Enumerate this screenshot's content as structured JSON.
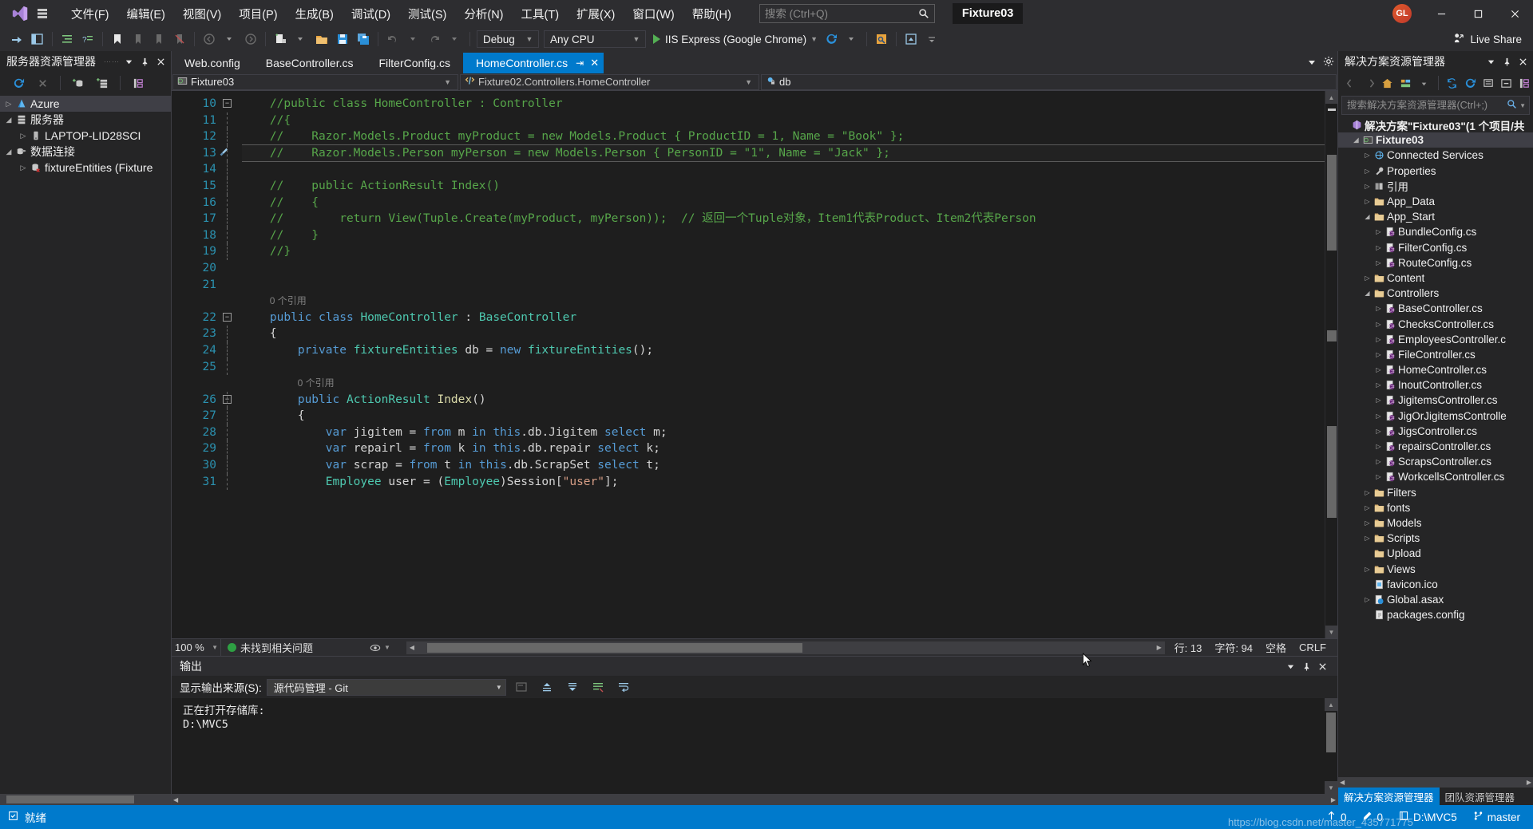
{
  "titlebar": {
    "menus": [
      "文件(F)",
      "编辑(E)",
      "视图(V)",
      "项目(P)",
      "生成(B)",
      "调试(D)",
      "测试(S)",
      "分析(N)",
      "工具(T)",
      "扩展(X)",
      "窗口(W)",
      "帮助(H)"
    ],
    "search_placeholder": "搜索 (Ctrl+Q)",
    "solution_chip": "Fixture03",
    "avatar_initials": "GL",
    "minimize": "—",
    "maximize": "▢",
    "close": "✕"
  },
  "toolbar": {
    "config": "Debug",
    "platform": "Any CPU",
    "run_target": "IIS Express (Google Chrome)",
    "live_share": "Live Share"
  },
  "server_explorer": {
    "title": "服务器资源管理器",
    "items": [
      {
        "label": "Azure",
        "icon": "azure-icon",
        "depth": 0,
        "arrow": "▷",
        "selected": true
      },
      {
        "label": "服务器",
        "icon": "server-icon",
        "depth": 0,
        "arrow": "◢",
        "selected": false
      },
      {
        "label": "LAPTOP-LID28SCI",
        "icon": "machine-icon",
        "depth": 1,
        "arrow": "▷",
        "selected": false
      },
      {
        "label": "数据连接",
        "icon": "datalink-icon",
        "depth": 0,
        "arrow": "◢",
        "selected": false
      },
      {
        "label": "fixtureEntities (Fixture",
        "icon": "db-error-icon",
        "depth": 1,
        "arrow": "▷",
        "selected": false
      }
    ]
  },
  "editor": {
    "tabs": [
      {
        "label": "Web.config",
        "active": false
      },
      {
        "label": "BaseController.cs",
        "active": false
      },
      {
        "label": "FilterConfig.cs",
        "active": false
      },
      {
        "label": "HomeController.cs",
        "active": true
      }
    ],
    "nav": {
      "project": "Fixture03",
      "type": "Fixture02.Controllers.HomeController",
      "member": "db"
    },
    "first_line": 10,
    "lines": [
      {
        "n": 10,
        "fold": "minus",
        "tokens": [
          {
            "t": "    //public class HomeController : Controller",
            "c": "cm"
          }
        ]
      },
      {
        "n": 11,
        "fold": "",
        "tokens": [
          {
            "t": "    //{",
            "c": "cm"
          }
        ]
      },
      {
        "n": 12,
        "fold": "",
        "tokens": [
          {
            "t": "    //    Razor.Models.Product myProduct = new Models.Product { ProductID = 1, Name = \"Book\" };",
            "c": "cm"
          }
        ]
      },
      {
        "n": 13,
        "fold": "",
        "glyph": "brush",
        "highlight": true,
        "tokens": [
          {
            "t": "    //    Razor.Models.Person myPerson = new Models.Person { PersonID = \"1\", Name = \"Jack\" };",
            "c": "cm"
          }
        ]
      },
      {
        "n": 14,
        "fold": "",
        "tokens": [
          {
            "t": "",
            "c": "pl"
          }
        ]
      },
      {
        "n": 15,
        "fold": "",
        "tokens": [
          {
            "t": "    //    public ActionResult Index()",
            "c": "cm"
          }
        ]
      },
      {
        "n": 16,
        "fold": "",
        "tokens": [
          {
            "t": "    //    {",
            "c": "cm"
          }
        ]
      },
      {
        "n": 17,
        "fold": "",
        "tokens": [
          {
            "t": "    //        return View(Tuple.Create(myProduct, myPerson));  // 返回一个Tuple对象，Item1代表Product、Item2代表Person",
            "c": "cm"
          }
        ]
      },
      {
        "n": 18,
        "fold": "",
        "tokens": [
          {
            "t": "    //    }",
            "c": "cm"
          }
        ]
      },
      {
        "n": 19,
        "fold": "",
        "tokens": [
          {
            "t": "    //}",
            "c": "cm"
          }
        ]
      },
      {
        "n": 20,
        "fold": "",
        "tokens": [
          {
            "t": "",
            "c": "pl"
          }
        ]
      },
      {
        "n": 21,
        "fold": "",
        "tokens": [
          {
            "t": "",
            "c": "pl"
          }
        ]
      },
      {
        "n": "",
        "fold": "",
        "codelens": "0 个引用",
        "indent": 4
      },
      {
        "n": 22,
        "fold": "minus",
        "tokens": [
          {
            "t": "    ",
            "c": "pl"
          },
          {
            "t": "public",
            "c": "kw"
          },
          {
            "t": " ",
            "c": "pl"
          },
          {
            "t": "class",
            "c": "kw"
          },
          {
            "t": " ",
            "c": "pl"
          },
          {
            "t": "HomeController",
            "c": "ty"
          },
          {
            "t": " : ",
            "c": "pl"
          },
          {
            "t": "BaseController",
            "c": "ty"
          }
        ]
      },
      {
        "n": 23,
        "fold": "",
        "tokens": [
          {
            "t": "    {",
            "c": "pl"
          }
        ]
      },
      {
        "n": 24,
        "fold": "",
        "tokens": [
          {
            "t": "        ",
            "c": "pl"
          },
          {
            "t": "private",
            "c": "kw"
          },
          {
            "t": " ",
            "c": "pl"
          },
          {
            "t": "fixtureEntities",
            "c": "ty"
          },
          {
            "t": " db = ",
            "c": "pl"
          },
          {
            "t": "new",
            "c": "kw"
          },
          {
            "t": " ",
            "c": "pl"
          },
          {
            "t": "fixtureEntities",
            "c": "ty"
          },
          {
            "t": "();",
            "c": "pl"
          }
        ]
      },
      {
        "n": 25,
        "fold": "",
        "tokens": [
          {
            "t": "",
            "c": "pl"
          }
        ]
      },
      {
        "n": "",
        "fold": "",
        "codelens": "0 个引用",
        "indent": 8
      },
      {
        "n": 26,
        "fold": "minus",
        "tokens": [
          {
            "t": "        ",
            "c": "pl"
          },
          {
            "t": "public",
            "c": "kw"
          },
          {
            "t": " ",
            "c": "pl"
          },
          {
            "t": "ActionResult",
            "c": "ty"
          },
          {
            "t": " ",
            "c": "pl"
          },
          {
            "t": "Index",
            "c": "mt"
          },
          {
            "t": "()",
            "c": "pl"
          }
        ]
      },
      {
        "n": 27,
        "fold": "",
        "tokens": [
          {
            "t": "        {",
            "c": "pl"
          }
        ]
      },
      {
        "n": 28,
        "fold": "",
        "tokens": [
          {
            "t": "            ",
            "c": "pl"
          },
          {
            "t": "var",
            "c": "kw"
          },
          {
            "t": " jigitem = ",
            "c": "pl"
          },
          {
            "t": "from",
            "c": "kw"
          },
          {
            "t": " m ",
            "c": "pl"
          },
          {
            "t": "in",
            "c": "kw"
          },
          {
            "t": " ",
            "c": "pl"
          },
          {
            "t": "this",
            "c": "kw"
          },
          {
            "t": ".db.Jigitem ",
            "c": "pl"
          },
          {
            "t": "select",
            "c": "kw"
          },
          {
            "t": " m;",
            "c": "pl"
          }
        ]
      },
      {
        "n": 29,
        "fold": "",
        "tokens": [
          {
            "t": "            ",
            "c": "pl"
          },
          {
            "t": "var",
            "c": "kw"
          },
          {
            "t": " repairl = ",
            "c": "pl"
          },
          {
            "t": "from",
            "c": "kw"
          },
          {
            "t": " k ",
            "c": "pl"
          },
          {
            "t": "in",
            "c": "kw"
          },
          {
            "t": " ",
            "c": "pl"
          },
          {
            "t": "this",
            "c": "kw"
          },
          {
            "t": ".db.repair ",
            "c": "pl"
          },
          {
            "t": "select",
            "c": "kw"
          },
          {
            "t": " k;",
            "c": "pl"
          }
        ]
      },
      {
        "n": 30,
        "fold": "",
        "tokens": [
          {
            "t": "            ",
            "c": "pl"
          },
          {
            "t": "var",
            "c": "kw"
          },
          {
            "t": " scrap = ",
            "c": "pl"
          },
          {
            "t": "from",
            "c": "kw"
          },
          {
            "t": " t ",
            "c": "pl"
          },
          {
            "t": "in",
            "c": "kw"
          },
          {
            "t": " ",
            "c": "pl"
          },
          {
            "t": "this",
            "c": "kw"
          },
          {
            "t": ".db.ScrapSet ",
            "c": "pl"
          },
          {
            "t": "select",
            "c": "kw"
          },
          {
            "t": " t;",
            "c": "pl"
          }
        ]
      },
      {
        "n": 31,
        "fold": "",
        "tokens": [
          {
            "t": "            ",
            "c": "pl"
          },
          {
            "t": "Employee",
            "c": "ty"
          },
          {
            "t": " user = (",
            "c": "pl"
          },
          {
            "t": "Employee",
            "c": "ty"
          },
          {
            "t": ")Session[",
            "c": "pl"
          },
          {
            "t": "\"user\"",
            "c": "st"
          },
          {
            "t": "];",
            "c": "pl"
          }
        ]
      }
    ],
    "status": {
      "zoom": "100 %",
      "issues": "未找到相关问题",
      "line": "行: 13",
      "col": "字符: 94",
      "space": "空格",
      "eol": "CRLF"
    }
  },
  "output": {
    "title": "输出",
    "source_label": "显示输出来源(S):",
    "source_value": "源代码管理 - Git",
    "body": "正在打开存储库:\nD:\\MVC5"
  },
  "solution_explorer": {
    "title": "解决方案资源管理器",
    "search_placeholder": "搜索解决方案资源管理器(Ctrl+;)",
    "nodes": [
      {
        "label": "解决方案\"Fixture03\"(1 个项目/共",
        "depth": 0,
        "arrow": "",
        "icon": "solution-icon",
        "bold": true
      },
      {
        "label": "Fixture03",
        "depth": 1,
        "arrow": "◢",
        "icon": "project-icon",
        "bold": true,
        "selected": true
      },
      {
        "label": "Connected Services",
        "depth": 2,
        "arrow": "▷",
        "icon": "services-icon"
      },
      {
        "label": "Properties",
        "depth": 2,
        "arrow": "▷",
        "icon": "wrench-icon"
      },
      {
        "label": "引用",
        "depth": 2,
        "arrow": "▷",
        "icon": "references-icon"
      },
      {
        "label": "App_Data",
        "depth": 2,
        "arrow": "▷",
        "icon": "folder-icon"
      },
      {
        "label": "App_Start",
        "depth": 2,
        "arrow": "◢",
        "icon": "folder-icon"
      },
      {
        "label": "BundleConfig.cs",
        "depth": 3,
        "arrow": "▷",
        "icon": "cs-icon"
      },
      {
        "label": "FilterConfig.cs",
        "depth": 3,
        "arrow": "▷",
        "icon": "cs-icon"
      },
      {
        "label": "RouteConfig.cs",
        "depth": 3,
        "arrow": "▷",
        "icon": "cs-icon"
      },
      {
        "label": "Content",
        "depth": 2,
        "arrow": "▷",
        "icon": "folder-icon"
      },
      {
        "label": "Controllers",
        "depth": 2,
        "arrow": "◢",
        "icon": "folder-icon"
      },
      {
        "label": "BaseController.cs",
        "depth": 3,
        "arrow": "▷",
        "icon": "cs-icon"
      },
      {
        "label": "ChecksController.cs",
        "depth": 3,
        "arrow": "▷",
        "icon": "cs-icon"
      },
      {
        "label": "EmployeesController.c",
        "depth": 3,
        "arrow": "▷",
        "icon": "cs-icon"
      },
      {
        "label": "FileController.cs",
        "depth": 3,
        "arrow": "▷",
        "icon": "cs-icon"
      },
      {
        "label": "HomeController.cs",
        "depth": 3,
        "arrow": "▷",
        "icon": "cs-icon"
      },
      {
        "label": "InoutController.cs",
        "depth": 3,
        "arrow": "▷",
        "icon": "cs-icon"
      },
      {
        "label": "JigitemsController.cs",
        "depth": 3,
        "arrow": "▷",
        "icon": "cs-icon"
      },
      {
        "label": "JigOrJigitemsControlle",
        "depth": 3,
        "arrow": "▷",
        "icon": "cs-icon"
      },
      {
        "label": "JigsController.cs",
        "depth": 3,
        "arrow": "▷",
        "icon": "cs-icon"
      },
      {
        "label": "repairsController.cs",
        "depth": 3,
        "arrow": "▷",
        "icon": "cs-icon"
      },
      {
        "label": "ScrapsController.cs",
        "depth": 3,
        "arrow": "▷",
        "icon": "cs-icon"
      },
      {
        "label": "WorkcellsController.cs",
        "depth": 3,
        "arrow": "▷",
        "icon": "cs-icon"
      },
      {
        "label": "Filters",
        "depth": 2,
        "arrow": "▷",
        "icon": "folder-icon"
      },
      {
        "label": "fonts",
        "depth": 2,
        "arrow": "▷",
        "icon": "folder-icon"
      },
      {
        "label": "Models",
        "depth": 2,
        "arrow": "▷",
        "icon": "folder-icon"
      },
      {
        "label": "Scripts",
        "depth": 2,
        "arrow": "▷",
        "icon": "folder-icon"
      },
      {
        "label": "Upload",
        "depth": 2,
        "arrow": "",
        "icon": "folder-icon"
      },
      {
        "label": "Views",
        "depth": 2,
        "arrow": "▷",
        "icon": "folder-icon"
      },
      {
        "label": "favicon.ico",
        "depth": 2,
        "arrow": "",
        "icon": "file-icon"
      },
      {
        "label": "Global.asax",
        "depth": 2,
        "arrow": "▷",
        "icon": "asax-icon"
      },
      {
        "label": "packages.config",
        "depth": 2,
        "arrow": "",
        "icon": "config-icon"
      }
    ],
    "tabs": [
      {
        "label": "解决方案资源管理器",
        "on": true
      },
      {
        "label": "团队资源管理器",
        "on": false
      }
    ]
  },
  "statusbar": {
    "ready": "就绪",
    "up_count": "0",
    "edit_count": "0",
    "branch": "master",
    "repo": "D:\\MVC5",
    "watermark": "https://blog.csdn.net/master_435771775"
  }
}
